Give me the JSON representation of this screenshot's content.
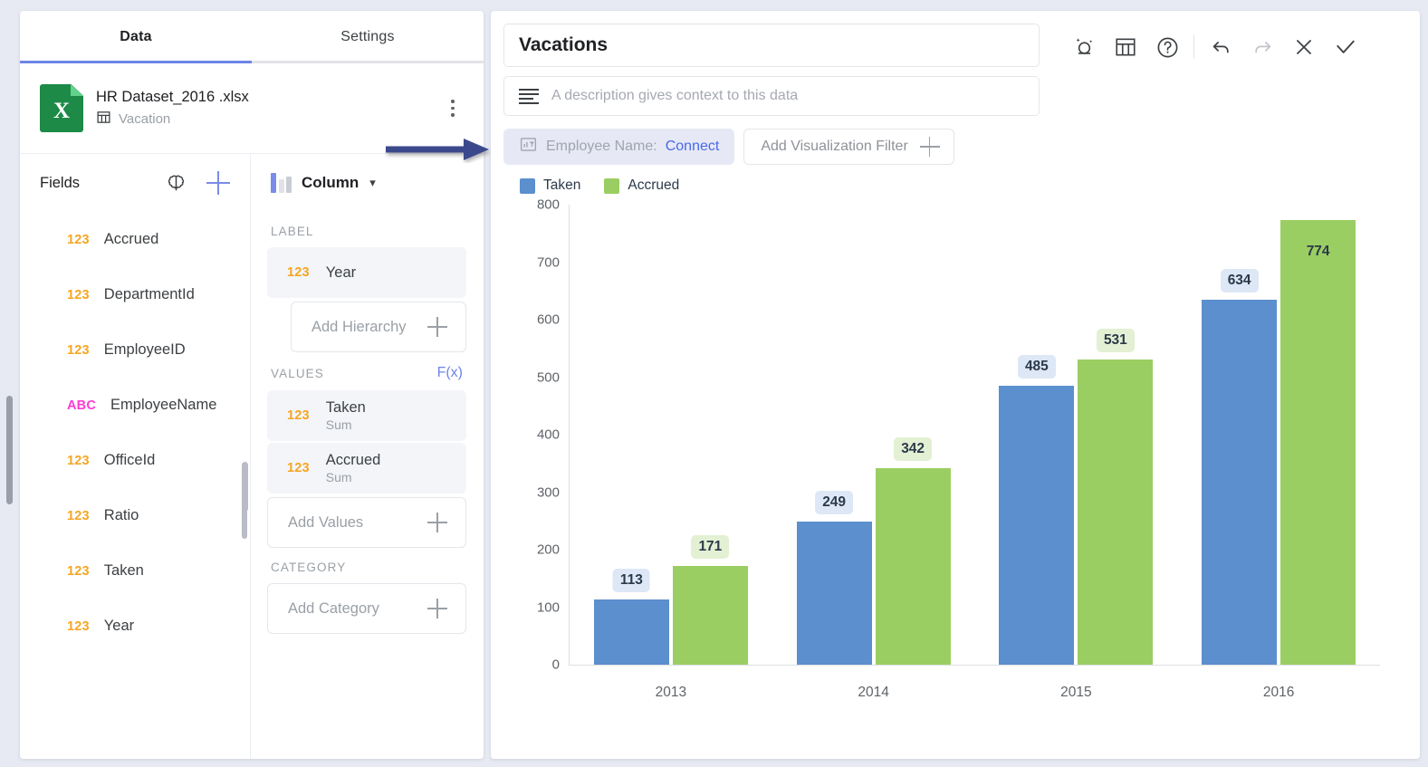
{
  "left_panel": {
    "tabs": [
      {
        "label": "Data",
        "active": true
      },
      {
        "label": "Settings",
        "active": false
      }
    ],
    "file": {
      "name": "HR Dataset_2016 .xlsx",
      "sheet": "Vacation",
      "icon": "excel-file-icon",
      "menu_icon": "kebab-menu-icon"
    },
    "fields_panel": {
      "title": "Fields",
      "ai_icon": "brain-icon",
      "add_icon": "plus-icon",
      "items": [
        {
          "type": "123",
          "label": "Accrued"
        },
        {
          "type": "123",
          "label": "DepartmentId"
        },
        {
          "type": "123",
          "label": "EmployeeID"
        },
        {
          "type": "ABC",
          "label": "EmployeeName"
        },
        {
          "type": "123",
          "label": "OfficeId"
        },
        {
          "type": "123",
          "label": "Ratio"
        },
        {
          "type": "123",
          "label": "Taken"
        },
        {
          "type": "123",
          "label": "Year"
        }
      ]
    },
    "config_panel": {
      "viz_type": "Column",
      "viz_chevron": "chevron-down-icon",
      "label_section": {
        "heading": "LABEL",
        "field": {
          "type": "123",
          "label": "Year"
        },
        "add_hierarchy": "Add Hierarchy"
      },
      "values_section": {
        "heading": "VALUES",
        "fx_label": "F(x)",
        "fields": [
          {
            "type": "123",
            "label": "Taken",
            "aggregation": "Sum"
          },
          {
            "type": "123",
            "label": "Accrued",
            "aggregation": "Sum"
          }
        ],
        "add_values": "Add Values"
      },
      "category_section": {
        "heading": "CATEGORY",
        "add_category": "Add Category"
      }
    }
  },
  "right_panel": {
    "title": "Vacations",
    "description_placeholder": "A description gives context to this data",
    "description_icon": "description-lines-icon",
    "toolbar": [
      {
        "name": "ai-insights-icon",
        "glyph": "ai",
        "dim": false
      },
      {
        "name": "data-table-icon",
        "glyph": "table",
        "dim": false
      },
      {
        "name": "help-icon",
        "glyph": "help",
        "dim": false
      },
      {
        "name": "undo-icon",
        "glyph": "undo",
        "dim": false
      },
      {
        "name": "redo-icon",
        "glyph": "redo",
        "dim": true
      },
      {
        "name": "close-icon",
        "glyph": "close",
        "dim": false
      },
      {
        "name": "apply-check-icon",
        "glyph": "check",
        "dim": false
      }
    ],
    "filters": {
      "active_filter_label": "Employee Name:",
      "active_filter_action": "Connect",
      "active_filter_icon": "chart-filter-icon",
      "add_filter_label": "Add Visualization Filter",
      "add_filter_icon": "plus-icon"
    }
  },
  "colors": {
    "taken": "#5b8fce",
    "accrued": "#9bce62",
    "taken_label_bg": "#dde7f5",
    "accrued_label_bg": "#e3f0d3",
    "accent": "#6e85e8",
    "link": "#4a68e8",
    "annotation_arrow": "#3b4a8c"
  },
  "annotation": {
    "arrow": "right-pointing-arrow-annotation"
  },
  "chart_data": {
    "type": "bar",
    "title": "Vacations",
    "categories": [
      "2013",
      "2014",
      "2015",
      "2016"
    ],
    "series": [
      {
        "name": "Taken",
        "color": "#5b8fce",
        "values": [
          113,
          249,
          485,
          634
        ]
      },
      {
        "name": "Accrued",
        "color": "#9bce62",
        "values": [
          171,
          342,
          531,
          774
        ]
      }
    ],
    "xlabel": "",
    "ylabel": "",
    "ylim": [
      0,
      800
    ],
    "yticks": [
      800,
      700,
      600,
      500,
      400,
      300,
      200,
      100,
      0
    ],
    "grid": false,
    "legend_position": "top-left",
    "data_labels": true,
    "label_placement": [
      "outside",
      "outside",
      "outside",
      "outside",
      "outside",
      "outside",
      "outside",
      "inside"
    ]
  }
}
